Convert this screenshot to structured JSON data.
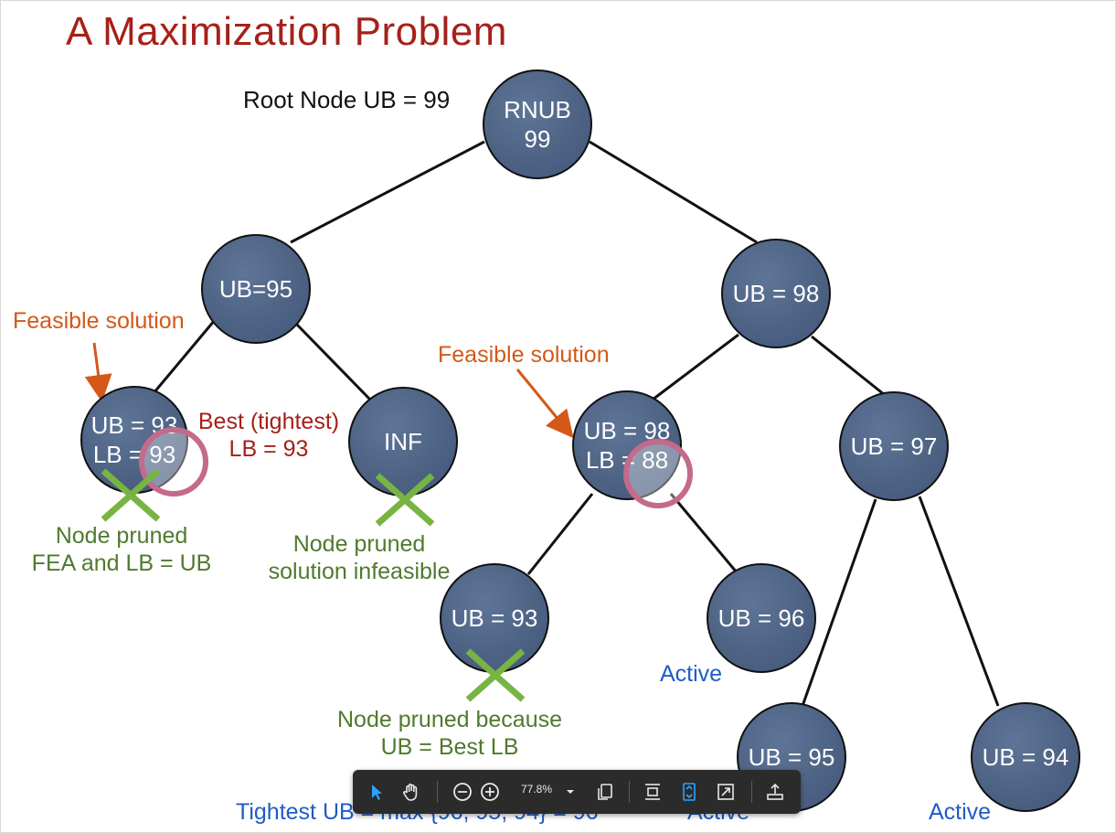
{
  "title": "A Maximization Problem",
  "nodes": {
    "root": {
      "line1": "RNUB",
      "line2": "99"
    },
    "n95": {
      "line1": "UB=95"
    },
    "n98": {
      "line1": "UB = 98"
    },
    "n93a": {
      "line1": "UB = 93",
      "line2": "LB = 93"
    },
    "inf": {
      "line1": "INF"
    },
    "n98b": {
      "line1": "UB = 98",
      "line2": "LB = 88"
    },
    "n97": {
      "line1": "UB = 97"
    },
    "n93b": {
      "line1": "UB = 93"
    },
    "n96": {
      "line1": "UB = 96"
    },
    "n95b": {
      "line1": "UB = 95"
    },
    "n94": {
      "line1": "UB = 94"
    }
  },
  "labels": {
    "root_ub": "Root Node UB = 99",
    "feasible_left": "Feasible solution",
    "feasible_right": "Feasible solution",
    "best_lb_1": "Best (tightest)",
    "best_lb_2": "LB = 93",
    "pruned_fea_1": "Node pruned",
    "pruned_fea_2": "FEA and LB = UB",
    "pruned_inf_1": "Node pruned",
    "pruned_inf_2": "solution infeasible",
    "pruned_ub_1": "Node pruned because",
    "pruned_ub_2": "UB = Best LB",
    "active_96": "Active",
    "active_95": "Active",
    "active_94": "Active",
    "tightest_ub": "Tightest UB = max {96, 95, 94} = 96"
  },
  "colors": {
    "title": "#a6201a",
    "node_fill": "#4e6384",
    "feasible": "#d4581a",
    "best_lb": "#a6201a",
    "pruned": "#4f7a2e",
    "active": "#1f5cc7",
    "cross": "#77b443",
    "highlight_ring": "#c46a8a"
  },
  "toolbar": {
    "zoom": "77.8%",
    "icons": [
      "select-cursor-icon",
      "hand-pan-icon",
      "zoom-out-icon",
      "zoom-in-icon",
      "zoom-dropdown-icon",
      "copy-pages-icon",
      "fit-height-icon",
      "fit-page-icon",
      "fullscreen-icon",
      "export-icon"
    ]
  }
}
